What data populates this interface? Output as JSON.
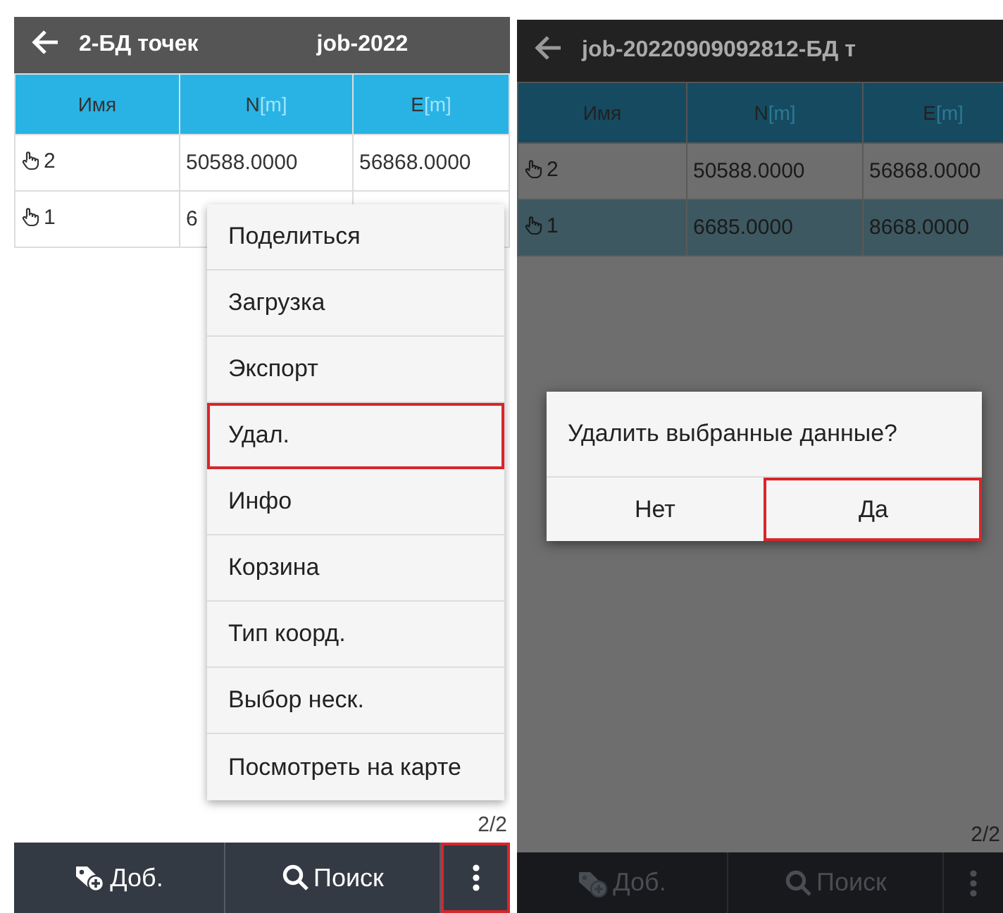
{
  "screens": [
    {
      "dimmed": false,
      "title_parts": [
        "2-БД точек",
        "job-2022"
      ],
      "columns": [
        {
          "label": "Имя"
        },
        {
          "label": "N",
          "unit": "[m]"
        },
        {
          "label": "E",
          "unit": "[m]"
        }
      ],
      "rows": [
        {
          "name": "2",
          "n": "50588.0000",
          "e": "56868.0000",
          "selected": false
        },
        {
          "name": "1",
          "n": "6",
          "selected": false
        }
      ],
      "pager": "2/2",
      "menu": [
        {
          "label": "Поделиться",
          "highlighted": false
        },
        {
          "label": "Загрузка",
          "highlighted": false
        },
        {
          "label": "Экспорт",
          "highlighted": false
        },
        {
          "label": "Удал.",
          "highlighted": true
        },
        {
          "label": "Инфо",
          "highlighted": false
        },
        {
          "label": "Корзина",
          "highlighted": false
        },
        {
          "label": "Тип коорд.",
          "highlighted": false
        },
        {
          "label": "Выбор неск.",
          "highlighted": false
        },
        {
          "label": "Посмотреть на карте",
          "highlighted": false
        }
      ],
      "toolbar": [
        {
          "kind": "add",
          "label": "Доб.",
          "highlighted": false
        },
        {
          "kind": "search",
          "label": "Поиск",
          "highlighted": false
        },
        {
          "kind": "more",
          "highlighted": true
        }
      ]
    },
    {
      "dimmed": true,
      "title_parts": [
        "job-20220909092812-БД т"
      ],
      "columns": [
        {
          "label": "Имя"
        },
        {
          "label": "N",
          "unit": "[m]"
        },
        {
          "label": "E",
          "unit": "[m]"
        }
      ],
      "rows": [
        {
          "name": "2",
          "n": "50588.0000",
          "e": "56868.0000",
          "selected": false
        },
        {
          "name": "1",
          "n": "6685.0000",
          "e": "8668.0000",
          "selected": true
        }
      ],
      "pager": "2/2",
      "dialog": {
        "message": "Удалить выбранные данные?",
        "buttons": [
          {
            "label": "Нет",
            "highlighted": false
          },
          {
            "label": "Да",
            "highlighted": true
          }
        ]
      },
      "toolbar": [
        {
          "kind": "add",
          "label": "Доб.",
          "highlighted": false
        },
        {
          "kind": "search",
          "label": "Поиск",
          "highlighted": false
        },
        {
          "kind": "more",
          "highlighted": false
        }
      ]
    }
  ]
}
